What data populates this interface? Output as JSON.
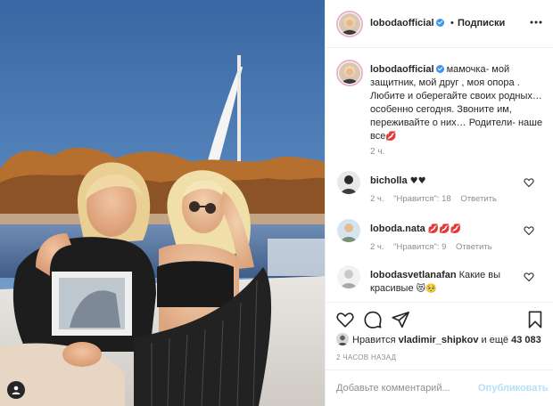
{
  "post": {
    "author": "lobodaofficial",
    "follow_dot": "•",
    "follow_label": "Подписки",
    "caption_text": "мамочка- мой защитник, мой друг , моя опора . Любите и оберегайте своих родных… особенно сегодня. Звоните им, переживайте о них… Родители- наше все",
    "caption_emoji": "💋",
    "caption_time": "2 ч."
  },
  "comments": [
    {
      "user": "bicholla",
      "text": "",
      "emoji": "♥♥",
      "time": "2 ч.",
      "likes": "\"Нравится\": 18",
      "reply": "Ответить"
    },
    {
      "user": "loboda.nata",
      "text": "",
      "emoji": "💋💋💋",
      "time": "2 ч.",
      "likes": "\"Нравится\": 9",
      "reply": "Ответить"
    },
    {
      "user": "lobodasvetlanafan",
      "text": "Какие вы красивые",
      "emoji": "😻🥺",
      "time": "",
      "likes": "",
      "reply": ""
    }
  ],
  "likes": {
    "prefix": "Нравится",
    "user": "vladimir_shipkov",
    "joiner": "и ещё",
    "count": "43 083"
  },
  "post_age": "2 ЧАСОВ НАЗАД",
  "add_comment": {
    "placeholder": "Добавьте комментарий...",
    "publish_label": "Опубликовать"
  },
  "icons": {
    "like": "heart-outline-icon",
    "comment": "speech-bubble-icon",
    "share": "paper-plane-icon",
    "save": "bookmark-icon",
    "more": "three-dots-icon",
    "verified": "verified-badge-icon",
    "tagged": "user-tag-icon"
  },
  "colors": {
    "text": "#262626",
    "secondary": "#8e8e8e",
    "border": "#efefef",
    "verified": "#3897f0",
    "publish_disabled": "#b2dffc"
  }
}
